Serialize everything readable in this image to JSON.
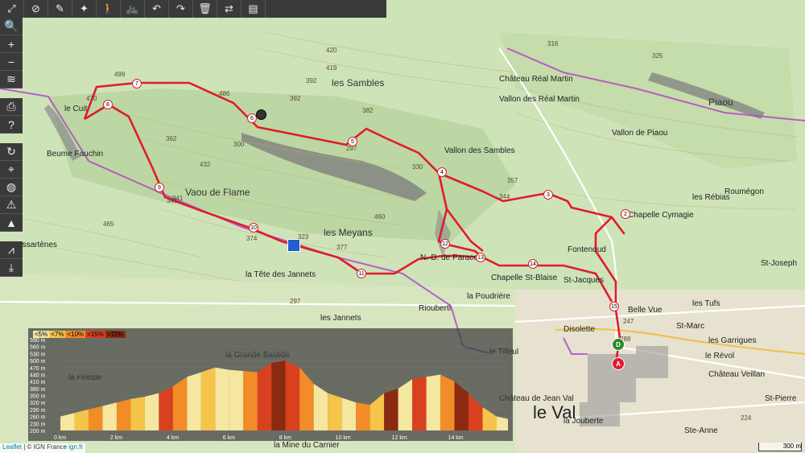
{
  "toolbar": {
    "top_icons": [
      "fullscreen-icon",
      "eye-off-icon",
      "draw-icon",
      "walker-icon",
      "cyclist-icon",
      "undo-icon",
      "redo-icon",
      "trash-icon",
      "swap-icon",
      "pin-list-icon",
      "location-icon"
    ],
    "top_glyphs": [
      "⤢",
      "⊘",
      "✎",
      "✦",
      "🚶",
      "🚲",
      "↶",
      "↷",
      "🗑",
      "⇄",
      "▤",
      "●"
    ],
    "left_icons": [
      "zoom-in-icon",
      "plus-icon",
      "minus-icon",
      "layers-icon",
      "print-icon",
      "help-icon",
      "refresh-icon",
      "crosshair-icon",
      "globe-icon",
      "warning-icon",
      "mountain-icon",
      "chart-icon",
      "download-icon"
    ],
    "left_glyphs": [
      "🔍",
      "+",
      "−",
      "≋",
      "⎙",
      "?",
      "↻",
      "⌖",
      "◍",
      "⚠",
      "▲",
      "⩘",
      "⤓"
    ]
  },
  "map_labels": [
    {
      "text": "le Cuit",
      "cls": ""
    },
    {
      "text": "les Sambles",
      "cls": "big"
    },
    {
      "text": "Château Réal Martin",
      "cls": ""
    },
    {
      "text": "Vallon des Réal Martin",
      "cls": ""
    },
    {
      "text": "Piaou",
      "cls": "big"
    },
    {
      "text": "Vaou de Flame",
      "cls": "big"
    },
    {
      "text": "les Meyans",
      "cls": "big"
    },
    {
      "text": "Les Essartènes",
      "cls": ""
    },
    {
      "text": "la Tête des Jannets",
      "cls": ""
    },
    {
      "text": "les Jannets",
      "cls": ""
    },
    {
      "text": "N.-D. de Paracol",
      "cls": ""
    },
    {
      "text": "Chapelle St-Blaise",
      "cls": ""
    },
    {
      "text": "la Poudrière",
      "cls": ""
    },
    {
      "text": "Riouberti",
      "cls": ""
    },
    {
      "text": "Chapelle Cymagie",
      "cls": ""
    },
    {
      "text": "Fontenoud",
      "cls": ""
    },
    {
      "text": "St-Jacques",
      "cls": ""
    },
    {
      "text": "Belle Vue",
      "cls": ""
    },
    {
      "text": "Disolette",
      "cls": ""
    },
    {
      "text": "le Val",
      "cls": "huge"
    },
    {
      "text": "la Jouberte",
      "cls": ""
    },
    {
      "text": "Ste-Anne",
      "cls": ""
    },
    {
      "text": "St-Marc",
      "cls": ""
    },
    {
      "text": "les Tufs",
      "cls": ""
    },
    {
      "text": "le Révol",
      "cls": ""
    },
    {
      "text": "Château Veillan",
      "cls": ""
    },
    {
      "text": "les Garrigues",
      "cls": ""
    },
    {
      "text": "St-Pierre",
      "cls": ""
    },
    {
      "text": "Roumégon",
      "cls": ""
    },
    {
      "text": "les Rébias",
      "cls": ""
    },
    {
      "text": "St-Joseph",
      "cls": ""
    },
    {
      "text": "Beume Fauchin",
      "cls": ""
    },
    {
      "text": "la Grande Bastide",
      "cls": ""
    },
    {
      "text": "la Floride",
      "cls": ""
    },
    {
      "text": "Château de Jean Val",
      "cls": ""
    },
    {
      "text": "le Tilleul",
      "cls": ""
    },
    {
      "text": "la Mine du Carnier",
      "cls": ""
    },
    {
      "text": "Vallon des Sambles",
      "cls": ""
    },
    {
      "text": "Vallon de Piaou",
      "cls": ""
    }
  ],
  "elevation_labels": [
    "392",
    "419",
    "420",
    "499",
    "470",
    "486",
    "392",
    "382",
    "297",
    "357",
    "344",
    "316",
    "325",
    "374",
    "323",
    "377",
    "297",
    "460",
    "432",
    "362",
    "341",
    "465",
    "330",
    "247",
    "288",
    "224",
    "300",
    "341"
  ],
  "waypoints": [
    "2",
    "3",
    "4",
    "5",
    "6",
    "7",
    "8",
    "9",
    "10",
    "11",
    "12",
    "13",
    "14",
    "15"
  ],
  "markers": {
    "start": "D",
    "end": "A"
  },
  "elevation_profile": {
    "legend": [
      "<5%",
      "<7%",
      "<10%",
      "<15%",
      ">15%"
    ],
    "legend_colors": [
      "#f5e6a0",
      "#f5c44a",
      "#f28c28",
      "#d94020",
      "#8b2a10"
    ],
    "y_ticks": [
      "590 m",
      "560 m",
      "530 m",
      "500 m",
      "470 m",
      "440 m",
      "410 m",
      "380 m",
      "350 m",
      "320 m",
      "290 m",
      "260 m",
      "230 m",
      "200 m"
    ],
    "x_ticks": [
      "0 km",
      "2 km",
      "4 km",
      "6 km",
      "8 km",
      "10 km",
      "12 km",
      "14 km"
    ],
    "profile_km": [
      0,
      0.5,
      1,
      1.5,
      2,
      2.5,
      3,
      3.5,
      4,
      4.5,
      5,
      5.5,
      6,
      6.5,
      7,
      7.5,
      8,
      8.5,
      9,
      9.5,
      10,
      10.5,
      11,
      11.5,
      12,
      12.5,
      13,
      13.5,
      14,
      14.5,
      15,
      15.5,
      15.9
    ],
    "profile_m": [
      260,
      275,
      290,
      305,
      320,
      335,
      345,
      360,
      390,
      430,
      450,
      470,
      460,
      455,
      450,
      490,
      500,
      470,
      400,
      360,
      340,
      320,
      310,
      360,
      380,
      420,
      430,
      440,
      410,
      360,
      300,
      260,
      250
    ],
    "bands": [
      "#f5e6a0",
      "#f5c44a",
      "#f28c28",
      "#f5e6a0",
      "#f28c28",
      "#f5c44a",
      "#f5e6a0",
      "#d94020",
      "#f28c28",
      "#f5e6a0",
      "#f5c44a",
      "#f5e6a0",
      "#f5e6a0",
      "#f28c28",
      "#d94020",
      "#8b2a10",
      "#d94020",
      "#f28c28",
      "#f5e6a0",
      "#f5c44a",
      "#f5e6a0",
      "#f28c28",
      "#f5c44a",
      "#8b2a10",
      "#f5e6a0",
      "#d94020",
      "#f5e6a0",
      "#f28c28",
      "#8b2a10",
      "#d94020",
      "#f5c44a",
      "#f5e6a0"
    ]
  },
  "attribution": {
    "leaflet": "Leaflet",
    "sep": " | © IGN France ",
    "ign": "ign.fr"
  },
  "scale_label": "300 m"
}
